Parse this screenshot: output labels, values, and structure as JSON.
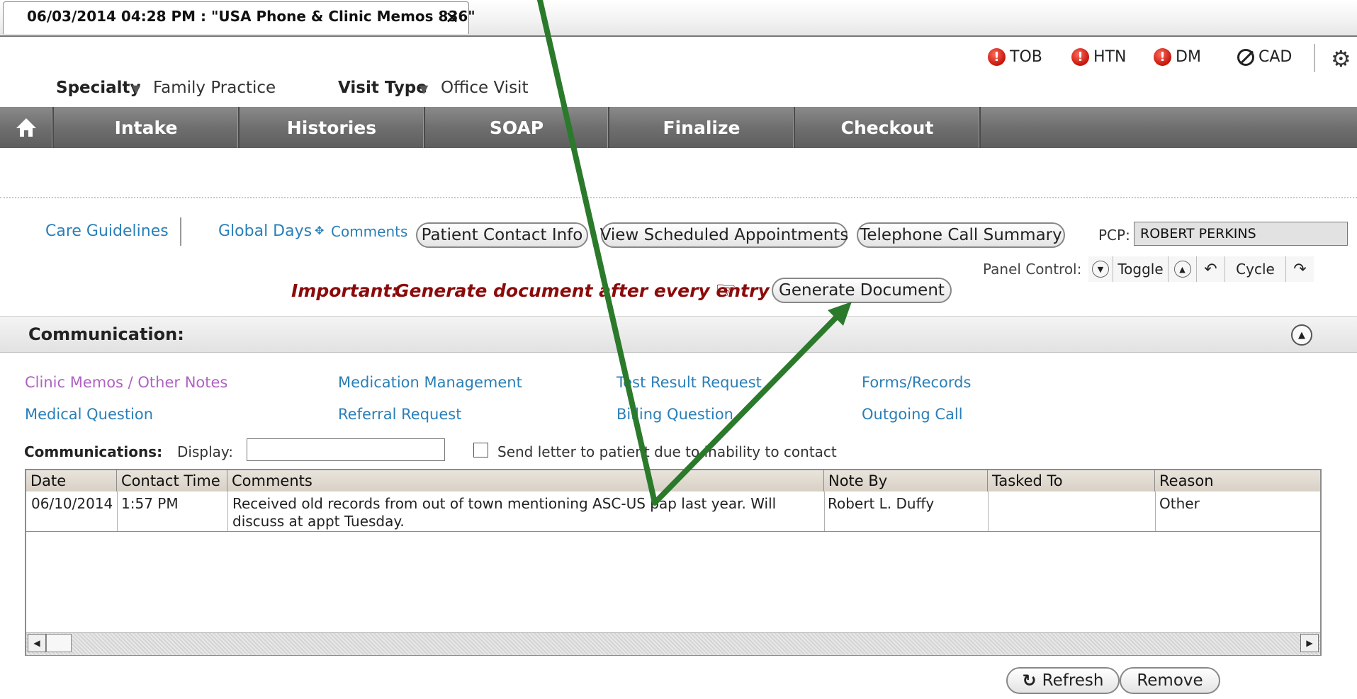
{
  "tab": {
    "title": "06/03/2014 04:28 PM : \"USA Phone & Clinic Memos 836\"",
    "close": "×"
  },
  "header": {
    "specialty_label": "Specialty",
    "specialty_value": "Family Practice",
    "visit_type_label": "Visit Type",
    "visit_type_value": "Office Visit",
    "flags": [
      "TOB",
      "HTN",
      "DM",
      "CAD"
    ]
  },
  "nav": {
    "tabs": [
      "Intake",
      "Histories",
      "SOAP",
      "Finalize",
      "Checkout"
    ]
  },
  "toolbar": {
    "care_guidelines": "Care Guidelines",
    "global_days": "Global Days",
    "comments": "Comments",
    "patient_contact_info": "Patient Contact Info",
    "view_scheduled_appointments": "View Scheduled Appointments",
    "telephone_call_summary": "Telephone Call Summary",
    "pcp_label": "PCP:",
    "pcp_value": "ROBERT PERKINS",
    "panel_control_label": "Panel Control:",
    "toggle": "Toggle",
    "cycle": "Cycle",
    "important_label": "Important:",
    "important_text": "Generate document after every entry",
    "generate_document": "Generate Document"
  },
  "section": {
    "title": "Communication:"
  },
  "categories": [
    {
      "label": "Clinic Memos / Other Notes",
      "color": "#b062c4"
    },
    {
      "label": "Medication Management",
      "color": "#2a7fb8"
    },
    {
      "label": "Test Result Request",
      "color": "#2a7fb8"
    },
    {
      "label": "Forms/Records",
      "color": "#2a7fb8"
    },
    {
      "label": "Medical Question",
      "color": "#2a7fb8"
    },
    {
      "label": "Referral Request",
      "color": "#2a7fb8"
    },
    {
      "label": "Billing Question",
      "color": "#2a7fb8"
    },
    {
      "label": "Outgoing Call",
      "color": "#2a7fb8"
    }
  ],
  "filters": {
    "communications_label": "Communications:",
    "display_label": "Display:",
    "display_value": "",
    "send_letter_label": "Send letter to patient due to inability to contact"
  },
  "table": {
    "headers": [
      "Date",
      "Contact Time",
      "Comments",
      "Note By",
      "Tasked To",
      "Reason"
    ],
    "rows": [
      {
        "date": "06/10/2014",
        "time": "1:57 PM",
        "comments_line1": "Received old records from out of town mentioning ASC-US pap last year.  Will",
        "comments_line2": "discuss at appt Tuesday.",
        "note_by": "Robert L. Duffy",
        "tasked_to": "",
        "reason": "Other"
      }
    ]
  },
  "actions": {
    "refresh": "Refresh",
    "remove": "Remove"
  },
  "colors": {
    "annotation_arrow": "#2b7a2b",
    "important_text": "#8b0a0a",
    "link": "#2a7fb8",
    "nav_bar": "#6f6f6f"
  }
}
